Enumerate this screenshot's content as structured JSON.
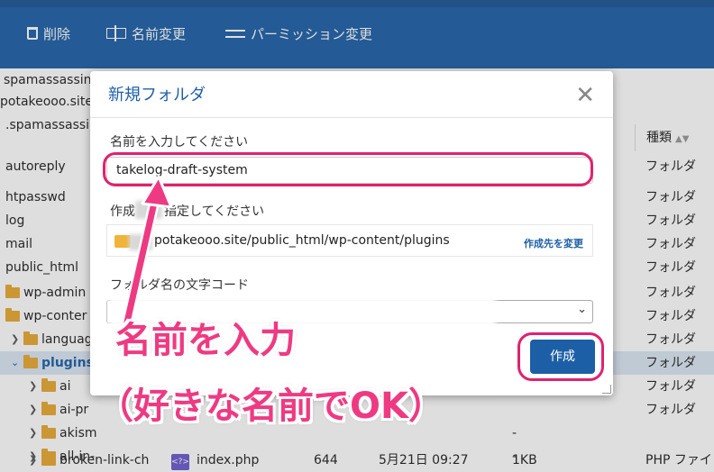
{
  "toolbar": {
    "delete_label": "削除",
    "rename_label": "名前変更",
    "permission_label": "パーミッション変更"
  },
  "tree": {
    "rows": [
      {
        "label": "spamassassin",
        "type": ""
      },
      {
        "label": "potakeooo.site",
        "type": ""
      },
      {
        "label": ".spamassassi",
        "type": ""
      },
      {
        "label": "autoreply",
        "type": "フォルダ"
      },
      {
        "label": "htpasswd",
        "type": "フォルダ"
      },
      {
        "label": "log",
        "type": "フォルダ"
      },
      {
        "label": "mail",
        "type": "フォルダ"
      },
      {
        "label": "public_html",
        "type": "フォルダ"
      },
      {
        "label": "wp-admin",
        "type": "フォルダ"
      },
      {
        "label": "wp-conter",
        "type": "フォルダ"
      },
      {
        "label": "languag",
        "type": "フォルダ"
      },
      {
        "label": "plugins",
        "type": "フォルダ"
      },
      {
        "label": "ai",
        "type": "フォルダ"
      },
      {
        "label": "ai-pr",
        "type": "フォルダ"
      },
      {
        "label": "akism",
        "type": "-"
      },
      {
        "label": "all-in-",
        "type": "-"
      },
      {
        "label": "broken-link-ch",
        "type": "PHP ファイ"
      }
    ],
    "type_header": "種類",
    "bottom_row": {
      "file": "index.php",
      "perm": "644",
      "date": "5月21日 09:27",
      "size": "1KB"
    }
  },
  "dialog": {
    "title": "新規フォルダ",
    "close_glyph": "✕",
    "name_label": "名前を入力してください",
    "name_value": "takelog-draft-system",
    "path_label_a": "作成",
    "path_label_b": "指定してください",
    "path_value": "potakeooo.site/public_html/wp-content/plugins",
    "change_path_label": "作成先を変更",
    "encoding_label": "フォルダ名の文字コード",
    "create_label": "作成"
  },
  "annotation": {
    "line1": "名前を入力",
    "line2": "（好きな名前でOK）",
    "color": "#ee3a82"
  },
  "colors": {
    "brand": "#1d5fa6",
    "highlight": "#e0226e"
  }
}
